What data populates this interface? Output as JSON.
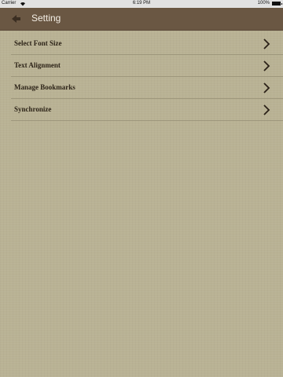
{
  "status_bar": {
    "carrier": "Carrier",
    "wifi_icon": "wifi-icon",
    "time": "6:19 PM",
    "battery": "100%",
    "battery_icon": "battery-icon"
  },
  "nav_bar": {
    "back_icon": "back-arrow-icon",
    "title": "Setting"
  },
  "settings": {
    "items": [
      {
        "label": "Select Font Size",
        "icon": "chevron-right-icon"
      },
      {
        "label": "Text Alignment",
        "icon": "chevron-right-icon"
      },
      {
        "label": "Manage Bookmarks",
        "icon": "chevron-right-icon"
      },
      {
        "label": "Synchronize",
        "icon": "chevron-right-icon"
      }
    ]
  },
  "colors": {
    "nav_background": "#6a5743",
    "page_background": "#b9b294",
    "title_text": "#f4efe6",
    "row_text": "#2d2418"
  }
}
